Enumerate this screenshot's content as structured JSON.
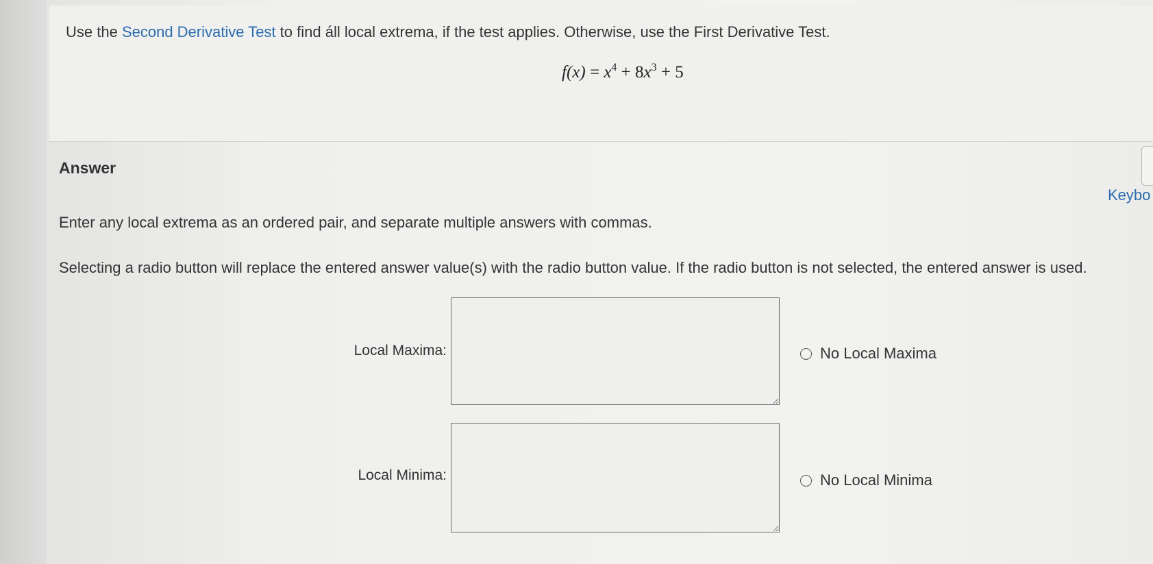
{
  "question": {
    "prefix": "Use the ",
    "link_text": "Second Derivative Test",
    "suffix": " to find áll local extrema, if the test applies. Otherwise, use the First Derivative Test.",
    "formula": {
      "lhs": "f(x)",
      "equals": "=",
      "term1_base": "x",
      "term1_exp": "4",
      "plus1": "+",
      "term2_coef": "8",
      "term2_base": "x",
      "term2_exp": "3",
      "plus2": "+",
      "constant": "5"
    }
  },
  "answer": {
    "heading": "Answer",
    "keyboard_link": "Keybo",
    "instruction_1": "Enter any local extrema as an ordered pair, and separate multiple answers with commas.",
    "instruction_2": "Selecting a radio button will replace the entered answer value(s) with the radio button value. If the radio button is not selected, the entered answer is used.",
    "local_maxima": {
      "label": "Local Maxima:",
      "value": "",
      "radio_label": "No Local Maxima"
    },
    "local_minima": {
      "label": "Local Minima:",
      "value": "",
      "radio_label": "No Local Minima"
    }
  }
}
